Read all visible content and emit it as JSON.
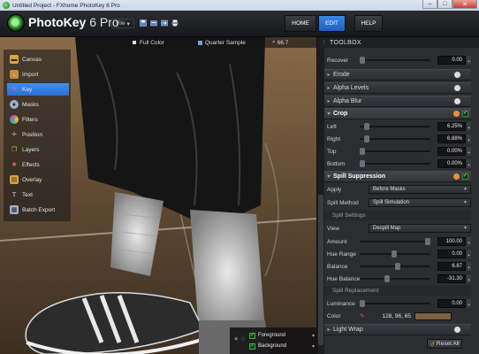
{
  "window": {
    "title": "Untitled Project - FXhome PhotoKey 6 Pro",
    "min": "–",
    "max": "□",
    "close": "✕"
  },
  "header": {
    "logo_name": "PhotoKey",
    "logo_version": "6 Pro",
    "file_menu": "File",
    "nav": [
      "HOME",
      "EDIT",
      "HELP"
    ]
  },
  "options_bar": {
    "color_mode": "Full Color",
    "quality": "Quarter Sample",
    "zoom": "66.7"
  },
  "tools": [
    {
      "label": "Canvas",
      "icon": "canvas-icon",
      "color": "#d9a640"
    },
    {
      "label": "Import",
      "icon": "import-icon",
      "color": "#c98a3a"
    },
    {
      "label": "Key",
      "icon": "key-icon",
      "color": "#c74343"
    },
    {
      "label": "Masks",
      "icon": "masks-icon",
      "color": "#9fb0c4"
    },
    {
      "label": "Filters",
      "icon": "filters-icon",
      "color": "#e64c8a"
    },
    {
      "label": "Position",
      "icon": "position-icon",
      "color": "#d9a640"
    },
    {
      "label": "Layers",
      "icon": "layers-icon",
      "color": "#d9a640"
    },
    {
      "label": "Effects",
      "icon": "effects-icon",
      "color": "#c04b2a"
    },
    {
      "label": "Overlay",
      "icon": "overlay-icon",
      "color": "#d9a640"
    },
    {
      "label": "Text",
      "icon": "text-icon",
      "color": "#c8c8c8"
    },
    {
      "label": "Batch Export",
      "icon": "batch-export-icon",
      "color": "#9fb0c4"
    }
  ],
  "layers": {
    "foreground": "Foreground",
    "background": "Background"
  },
  "toolbox": {
    "title": "TOOLBOX",
    "recover": {
      "label": "Recover",
      "value": "0.00",
      "fraction": 0.0
    },
    "sections_collapsed": [
      "Erode",
      "Alpha Levels",
      "Alpha Blur"
    ],
    "crop": {
      "title": "Crop",
      "rows": [
        {
          "label": "Left",
          "value": "6.25%",
          "fraction": 0.06
        },
        {
          "label": "Right",
          "value": "6.88%",
          "fraction": 0.07
        },
        {
          "label": "Top",
          "value": "0.00%",
          "fraction": 0.0
        },
        {
          "label": "Bottom",
          "value": "0.00%",
          "fraction": 0.0
        }
      ]
    },
    "spill": {
      "title": "Spill Suppression",
      "apply_label": "Apply",
      "apply_value": "Before Masks",
      "method_label": "Spill Method",
      "method_value": "Spill Simulation",
      "settings_head": "Spill Settings",
      "view_label": "View",
      "view_value": "Despill Map",
      "rows": [
        {
          "label": "Amount",
          "value": "100.00",
          "fraction": 1.0
        },
        {
          "label": "Hue Range",
          "value": "0.00",
          "fraction": 0.45
        },
        {
          "label": "Balance",
          "value": "6.87",
          "fraction": 0.5
        },
        {
          "label": "Hue Balance",
          "value": "-31.30",
          "fraction": 0.35
        }
      ],
      "replacement_head": "Spill Replacement",
      "luminance": {
        "label": "Luminance",
        "value": "0.00",
        "fraction": 0.0
      },
      "color_label": "Color",
      "color_value": "128, 96, 65",
      "color_hex": "#806041"
    },
    "light_wrap": "Light Wrap",
    "reset": "Reset All"
  }
}
